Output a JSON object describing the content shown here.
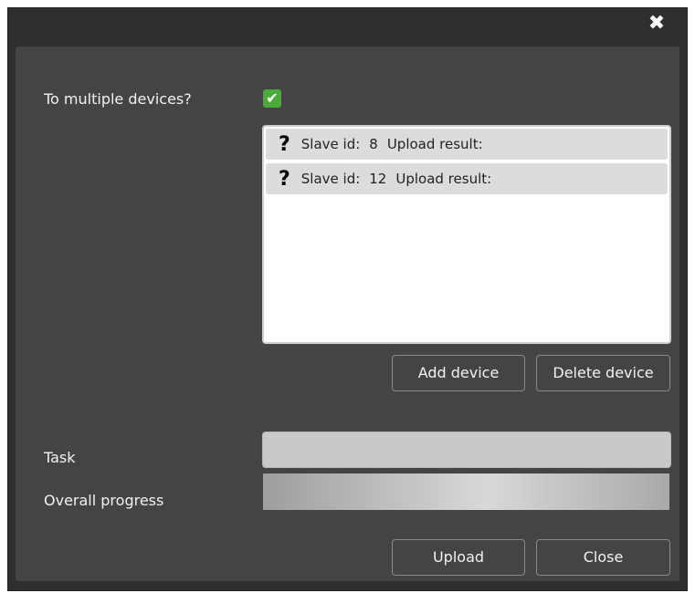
{
  "window": {
    "close_glyph": "✖"
  },
  "options": {
    "multiple_devices_label": "To multiple devices?",
    "multiple_devices_checked": true,
    "check_glyph": "✔"
  },
  "devices": [
    {
      "status_glyph": "?",
      "slave_label": "Slave id:",
      "slave_id": "8",
      "result_label": "Upload result:",
      "result": ""
    },
    {
      "status_glyph": "?",
      "slave_label": "Slave id:",
      "slave_id": "12",
      "result_label": "Upload result:",
      "result": ""
    }
  ],
  "device_buttons": {
    "add_label": "Add device",
    "delete_label": "Delete device"
  },
  "task": {
    "label": "Task",
    "value": ""
  },
  "progress": {
    "label": "Overall progress",
    "value": 0
  },
  "footer": {
    "upload_label": "Upload",
    "close_label": "Close"
  },
  "colors": {
    "checkbox_accent": "#4caa3a",
    "window_bg": "#2f2f2f",
    "panel_bg": "#444444"
  }
}
